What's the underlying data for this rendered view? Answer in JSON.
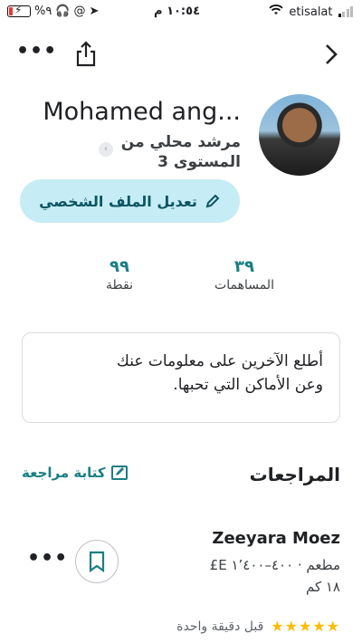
{
  "status_bar": {
    "battery_percent": "%٩",
    "time": "١٠:٥٤ م",
    "carrier": "etisalat"
  },
  "profile": {
    "name": "Mohamed ang...",
    "level_line1": "مرشد محلي من",
    "level_line2": "المستوى 3",
    "edit_button": "تعديل الملف الشخصي"
  },
  "stats": [
    {
      "value": "٣٩",
      "label": "المساهمات"
    },
    {
      "value": "٩٩",
      "label": "نقطة"
    }
  ],
  "info_card": {
    "line1": "أطلع الآخرين على معلومات عنك",
    "line2": "وعن الأماكن التي تحبها."
  },
  "reviews": {
    "title": "المراجعات",
    "write_link": "كتابة مراجعة",
    "items": [
      {
        "place": "Zeeyara Moez",
        "category_price": "مطعم · ٤٠٠–١٬٤٠٠ E£",
        "distance": "١٨ كم",
        "rating": 5,
        "time_ago": "قبل دقيقة واحدة"
      }
    ]
  },
  "colors": {
    "accent": "#1a7f83",
    "edit_button_bg": "#c6ecf5",
    "star": "#fbbc04"
  },
  "icons": [
    "more-icon",
    "share-icon",
    "chevron-right-icon",
    "pencil-icon",
    "edit-note-icon",
    "bookmark-icon",
    "star-icon",
    "wifi-icon",
    "location-icon"
  ]
}
